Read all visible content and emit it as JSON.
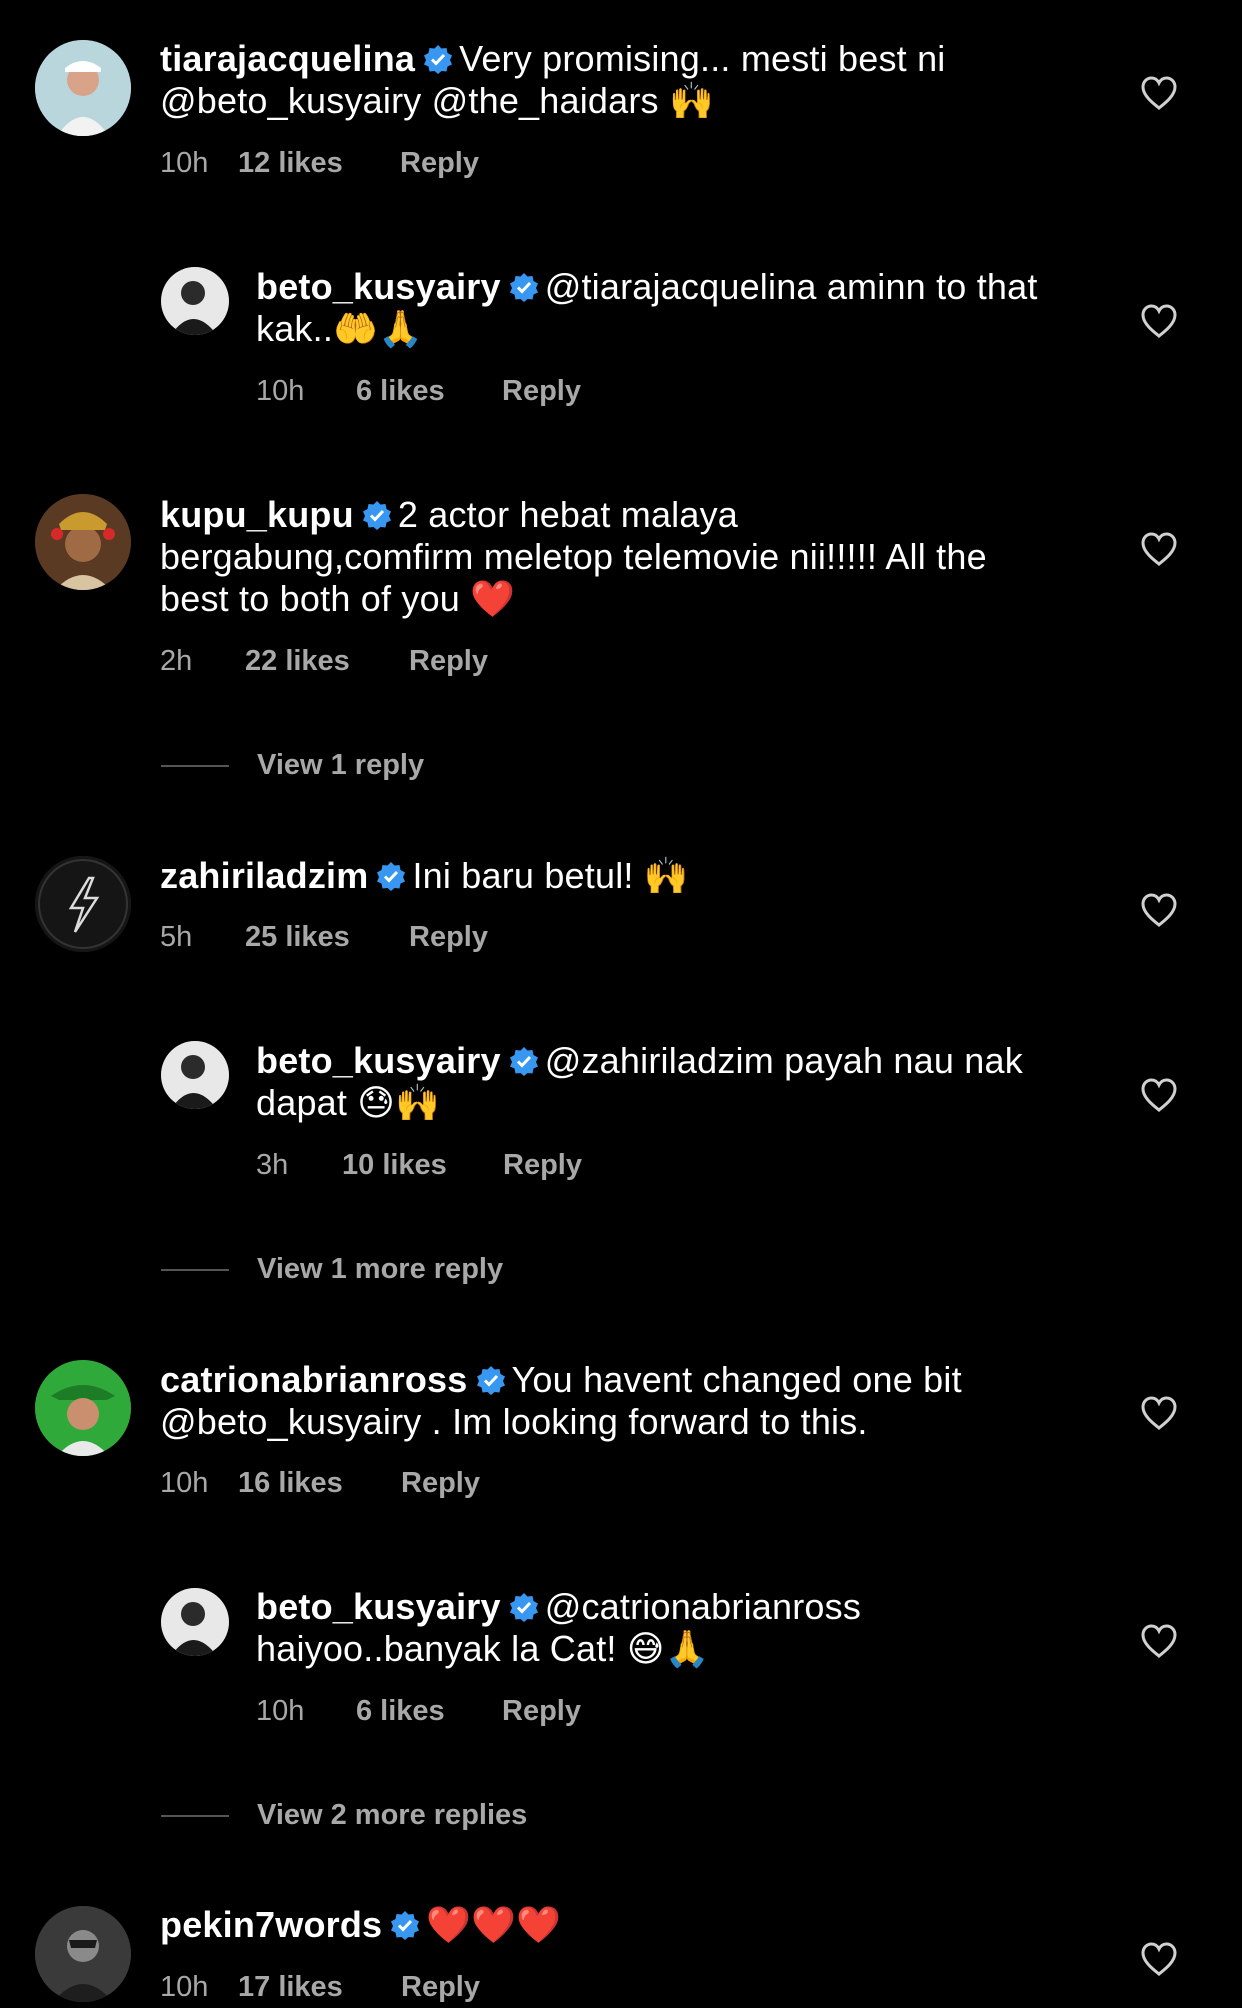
{
  "comments": [
    {
      "username": "tiarajacquelina",
      "text": "Very promising... mesti best ni @beto_kusyairy @the_haidars 🙌",
      "time": "10h",
      "likes": "12 likes",
      "reply": "Reply",
      "avatar_color": "#7aa8b5"
    },
    {
      "username": "beto_kusyairy",
      "text": "@tiarajacquelina aminn to that kak..🤲🙏",
      "time": "10h",
      "likes": "6 likes",
      "reply": "Reply",
      "avatar_color": "#2a2a2a"
    },
    {
      "username": "kupu_kupu",
      "text": "2 actor hebat malaya bergabung,comfirm meletop telemovie nii!!!!! All the best to both of you ❤️",
      "time": "2h",
      "likes": "22 likes",
      "reply": "Reply",
      "avatar_color": "#7a4a2a"
    },
    {
      "username": "zahiriladzim",
      "text": "Ini baru betul! 🙌",
      "time": "5h",
      "likes": "25 likes",
      "reply": "Reply",
      "avatar_color": "#111111"
    },
    {
      "username": "beto_kusyairy",
      "text": "@zahiriladzim payah nau nak dapat 😓🙌",
      "time": "3h",
      "likes": "10 likes",
      "reply": "Reply",
      "avatar_color": "#2a2a2a"
    },
    {
      "username": "catrionabrianross",
      "text": "You havent changed one bit @beto_kusyairy . Im looking forward to this.",
      "time": "10h",
      "likes": "16 likes",
      "reply": "Reply",
      "avatar_color": "#2faa3a"
    },
    {
      "username": "beto_kusyairy",
      "text": "@catrionabrianross haiyoo..banyak la Cat! 😅🙏",
      "time": "10h",
      "likes": "6 likes",
      "reply": "Reply",
      "avatar_color": "#2a2a2a"
    },
    {
      "username": "pekin7words",
      "text": "❤️❤️❤️",
      "time": "10h",
      "likes": "17 likes",
      "reply": "Reply",
      "avatar_color": "#444444"
    }
  ],
  "view_replies": [
    "View 1 reply",
    "View 1 more reply",
    "View 2 more replies"
  ],
  "colors": {
    "background": "#000000",
    "text": "#ffffff",
    "meta": "#a8a8a8",
    "verified": "#3897f0"
  },
  "icons": {
    "verified": "verified-badge-icon",
    "like": "heart-outline-icon"
  }
}
